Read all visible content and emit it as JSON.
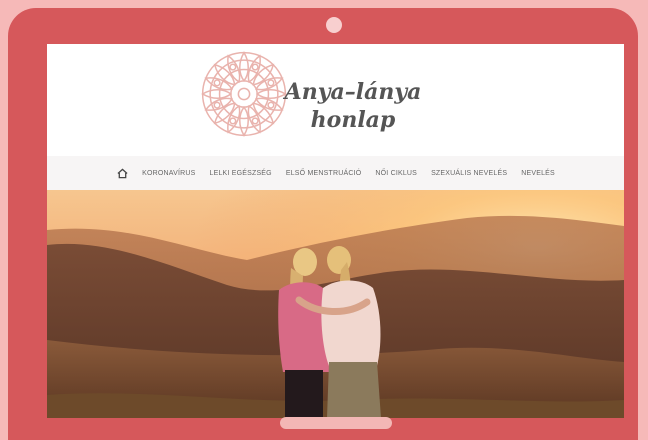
{
  "logo": {
    "line1": "Anya–lánya",
    "line2": "honlap",
    "mandala_color": "#e9b3ad"
  },
  "nav": {
    "home_icon": "home-icon",
    "items": [
      {
        "label": "KORONAVÍRUS"
      },
      {
        "label": "LELKI EGÉSZSÉG"
      },
      {
        "label": "ELSŐ MENSTRUÁCIÓ"
      },
      {
        "label": "NŐI CIKLUS"
      },
      {
        "label": "SZEXUÁLIS NEVELÉS"
      },
      {
        "label": "NEVELÉS"
      }
    ]
  },
  "hero": {
    "image": "mother-daughter-sunset-photo"
  },
  "device": {
    "frame_color": "#d6585b",
    "background_color": "#f6b9b8"
  }
}
